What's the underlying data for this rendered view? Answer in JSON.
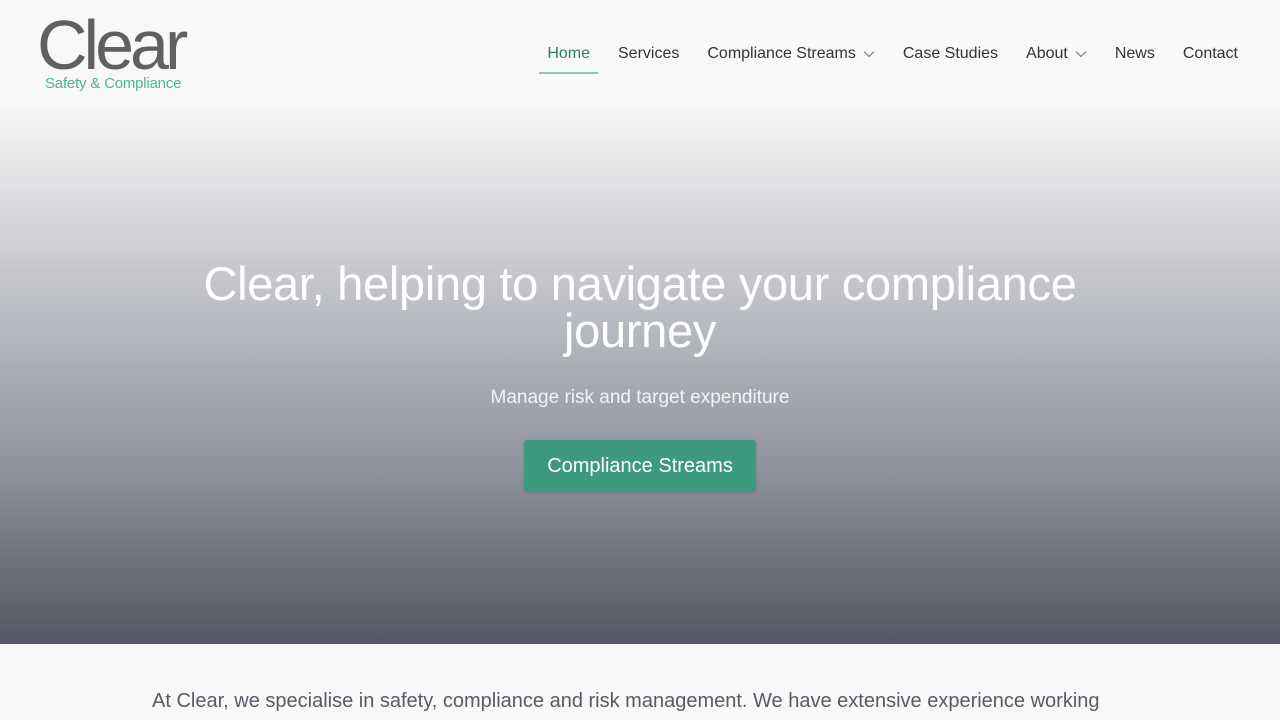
{
  "header": {
    "logo": {
      "word": "Clear",
      "tagline": "Safety & Compliance"
    },
    "nav": [
      {
        "label": "Home",
        "active": true
      },
      {
        "label": "Services"
      },
      {
        "label": "Compliance Streams",
        "has_dropdown": true
      },
      {
        "label": "Case Studies"
      },
      {
        "label": "About",
        "has_dropdown": true
      },
      {
        "label": "News"
      },
      {
        "label": "Contact"
      }
    ]
  },
  "hero": {
    "title": "Clear, helping to navigate your compliance journey",
    "subtitle": "Manage risk and target expenditure",
    "cta_label": "Compliance Streams"
  },
  "intro": {
    "text": "At Clear, we specialise in safety, compliance and risk management. We have extensive experience working"
  },
  "colors": {
    "accent": "#3d9a7e",
    "nav_active": "#2f7d62",
    "logo_grey": "#606060",
    "logo_green": "#4fb58f"
  },
  "icons": {
    "dropdown": "chevron-down-icon"
  }
}
